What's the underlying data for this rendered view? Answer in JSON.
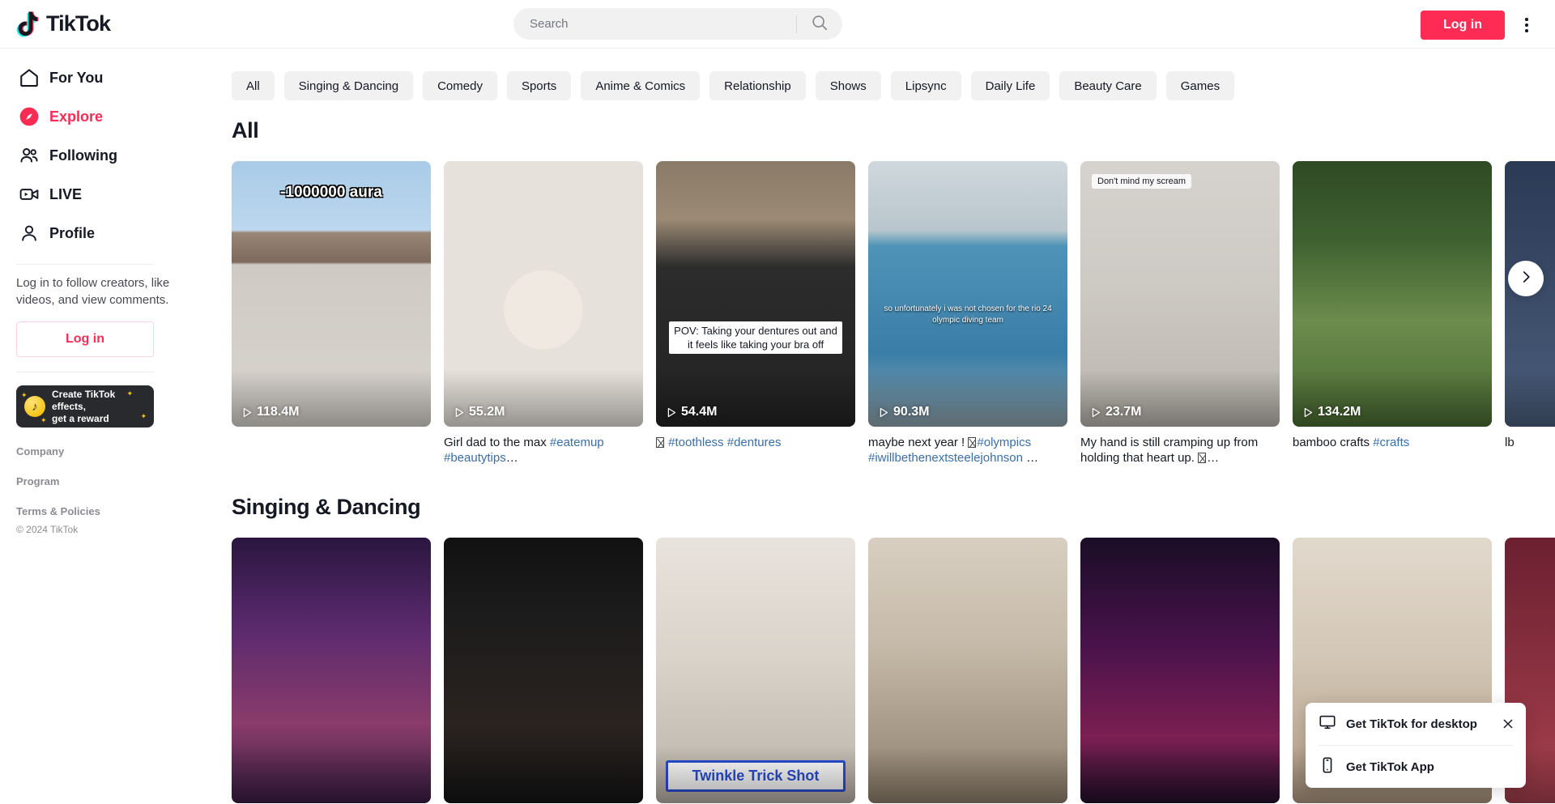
{
  "header": {
    "logo_text": "TikTok",
    "logo_icon": "tiktok-note-icon",
    "search": {
      "value": "",
      "placeholder": "Search",
      "icon": "search-icon"
    },
    "login_label": "Log in",
    "menu_icon": "kebab-menu-icon",
    "accent_color": "#FE2C55"
  },
  "sidebar": {
    "items": [
      {
        "label": "For You",
        "icon": "home-icon",
        "active": false
      },
      {
        "label": "Explore",
        "icon": "compass-icon",
        "active": true
      },
      {
        "label": "Following",
        "icon": "people-icon",
        "active": false
      },
      {
        "label": "LIVE",
        "icon": "live-video-icon",
        "active": false
      },
      {
        "label": "Profile",
        "icon": "person-icon",
        "active": false
      }
    ],
    "login_note": "Log in to follow creators, like videos, and view comments.",
    "login_label": "Log in",
    "effects_banner": {
      "line1": "Create TikTok effects,",
      "line2": "get a reward",
      "icon": "tiktok-coin-icon"
    },
    "footer_links": [
      "Company",
      "Program",
      "Terms & Policies"
    ],
    "copyright": "© 2024 TikTok"
  },
  "main": {
    "chips": [
      {
        "label": "All",
        "active": true
      },
      {
        "label": "Singing & Dancing",
        "active": false
      },
      {
        "label": "Comedy",
        "active": false
      },
      {
        "label": "Sports",
        "active": false
      },
      {
        "label": "Anime & Comics",
        "active": false
      },
      {
        "label": "Relationship",
        "active": false
      },
      {
        "label": "Shows",
        "active": false
      },
      {
        "label": "Lipsync",
        "active": false
      },
      {
        "label": "Daily Life",
        "active": false
      },
      {
        "label": "Beauty Care",
        "active": false
      },
      {
        "label": "Games",
        "active": false
      }
    ],
    "next_arrow_icon": "chevron-right-icon",
    "sections": [
      {
        "title": "All",
        "cards": [
          {
            "views": "118.4M",
            "caption_parts": [],
            "overlay": {
              "type": "aura",
              "text": "-1000000 aura"
            },
            "bg": "suburb"
          },
          {
            "views": "55.2M",
            "caption_parts": [
              {
                "t": "Girl dad to the max ",
                "tag": false
              },
              {
                "t": "#eatemup",
                "tag": true
              },
              {
                "t": " ",
                "tag": false
              },
              {
                "t": "#beautytips",
                "tag": true
              },
              {
                "t": "…",
                "tag": false
              }
            ],
            "overlay": null,
            "bg": "rainbow"
          },
          {
            "views": "54.4M",
            "caption_parts": [
              {
                "t": "",
                "tofu": true
              },
              {
                "t": " ",
                "tag": false
              },
              {
                "t": "#toothless",
                "tag": true
              },
              {
                "t": " ",
                "tag": false
              },
              {
                "t": "#dentures",
                "tag": true
              }
            ],
            "overlay": {
              "type": "whitebox",
              "text": "POV: Taking your dentures out and it feels like taking your bra off"
            },
            "bg": "dentures"
          },
          {
            "views": "90.3M",
            "caption_parts": [
              {
                "t": "maybe next year ! ",
                "tag": false
              },
              {
                "t": "",
                "tofu": true
              },
              {
                "t": "#olympics",
                "tag": true
              },
              {
                "t": " ",
                "tag": false
              },
              {
                "t": "#iwillbethenextsteelejohnson",
                "tag": true
              },
              {
                "t": " …",
                "tag": false
              }
            ],
            "overlay": {
              "type": "dark",
              "text": "so unfortunately i was not chosen for the rio 24 olympic diving team"
            },
            "bg": "pool"
          },
          {
            "views": "23.7M",
            "caption_parts": [
              {
                "t": "My hand is still cramping up from holding that heart up. ",
                "tag": false
              },
              {
                "t": "",
                "tofu": true
              },
              {
                "t": "…",
                "tag": false
              }
            ],
            "overlay": {
              "type": "chip",
              "text": "Don't mind my scream"
            },
            "bg": "classroom"
          },
          {
            "views": "134.2M",
            "caption_parts": [
              {
                "t": "bamboo crafts ",
                "tag": false
              },
              {
                "t": "#crafts",
                "tag": true
              }
            ],
            "overlay": null,
            "bg": "bamboo"
          },
          {
            "views": "",
            "caption_parts": [
              {
                "t": "lb",
                "tag": false
              }
            ],
            "overlay": null,
            "bg": "partial"
          }
        ]
      },
      {
        "title": "Singing & Dancing",
        "cards": [
          {
            "views": "",
            "caption_parts": [],
            "overlay": null,
            "bg": "party"
          },
          {
            "views": "",
            "caption_parts": [],
            "overlay": null,
            "bg": "trio"
          },
          {
            "views": "",
            "caption_parts": [],
            "overlay": {
              "type": "twinkle",
              "text": "Twinkle Trick Shot"
            },
            "bg": "livingroom"
          },
          {
            "views": "",
            "caption_parts": [],
            "overlay": null,
            "bg": "kitchen"
          },
          {
            "views": "",
            "caption_parts": [],
            "overlay": null,
            "bg": "concert"
          },
          {
            "views": "",
            "caption_parts": [],
            "overlay": null,
            "bg": "room"
          },
          {
            "views": "",
            "caption_parts": [],
            "overlay": null,
            "bg": "partial2"
          }
        ]
      }
    ]
  },
  "desktop_popup": {
    "rows": [
      {
        "label": "Get TikTok for desktop",
        "icon": "monitor-icon"
      },
      {
        "label": "Get TikTok App",
        "icon": "phone-icon"
      }
    ],
    "close_icon": "close-icon"
  }
}
